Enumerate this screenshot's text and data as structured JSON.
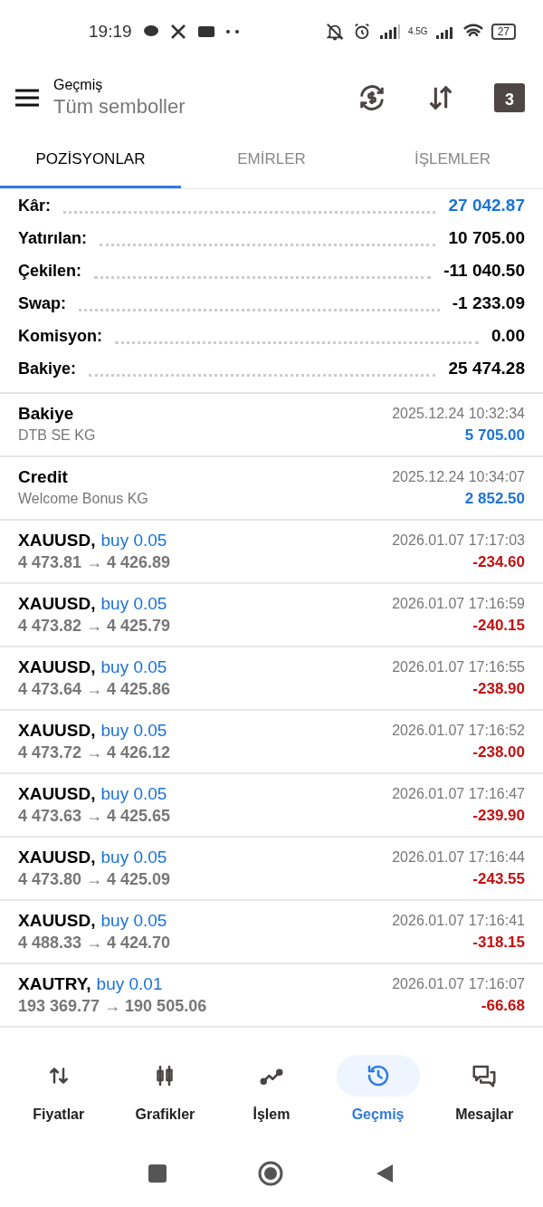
{
  "status_bar": {
    "time": "19:19",
    "network": "4.5G",
    "battery": "27"
  },
  "header": {
    "title": "Geçmiş",
    "subtitle": "Tüm semboller",
    "calendar_day": "3"
  },
  "tabs": [
    {
      "label": "POZİSYONLAR",
      "selected": true
    },
    {
      "label": "EMİRLER",
      "selected": false
    },
    {
      "label": "İŞLEMLER",
      "selected": false
    }
  ],
  "summary": [
    {
      "label": "Kâr:",
      "value": "27 042.87",
      "highlighted": true
    },
    {
      "label": "Yatırılan:",
      "value": "10 705.00",
      "highlighted": false
    },
    {
      "label": "Çekilen:",
      "value": "-11 040.50",
      "highlighted": false
    },
    {
      "label": "Swap:",
      "value": "-1 233.09",
      "highlighted": false
    },
    {
      "label": "Komisyon:",
      "value": "0.00",
      "highlighted": false
    },
    {
      "label": "Bakiye:",
      "value": "25 474.28",
      "highlighted": false
    }
  ],
  "deals": [
    {
      "kind": "balance",
      "title": "Bakiye",
      "comment": "DTB SE KG",
      "time": "2025.12.24 10:32:34",
      "amount": "5 705.00",
      "color": "#1a73d9"
    },
    {
      "kind": "balance",
      "title": "Credit",
      "comment": "Welcome Bonus KG",
      "time": "2025.12.24 10:34:07",
      "amount": "2 852.50",
      "color": "#1a73d9"
    },
    {
      "kind": "trade",
      "title": "XAUUSD,",
      "side": "buy 0.05",
      "prices": "4 473.81 → 4 426.89",
      "time": "2026.01.07 17:17:03",
      "amount": "-234.60",
      "color": "#c41010"
    },
    {
      "kind": "trade",
      "title": "XAUUSD,",
      "side": "buy 0.05",
      "prices": "4 473.82 → 4 425.79",
      "time": "2026.01.07 17:16:59",
      "amount": "-240.15",
      "color": "#c41010"
    },
    {
      "kind": "trade",
      "title": "XAUUSD,",
      "side": "buy 0.05",
      "prices": "4 473.64 → 4 425.86",
      "time": "2026.01.07 17:16:55",
      "amount": "-238.90",
      "color": "#c41010"
    },
    {
      "kind": "trade",
      "title": "XAUUSD,",
      "side": "buy 0.05",
      "prices": "4 473.72 → 4 426.12",
      "time": "2026.01.07 17:16:52",
      "amount": "-238.00",
      "color": "#c41010"
    },
    {
      "kind": "trade",
      "title": "XAUUSD,",
      "side": "buy 0.05",
      "prices": "4 473.63 → 4 425.65",
      "time": "2026.01.07 17:16:47",
      "amount": "-239.90",
      "color": "#c41010"
    },
    {
      "kind": "trade",
      "title": "XAUUSD,",
      "side": "buy 0.05",
      "prices": "4 473.80 → 4 425.09",
      "time": "2026.01.07 17:16:44",
      "amount": "-243.55",
      "color": "#c41010"
    },
    {
      "kind": "trade",
      "title": "XAUUSD,",
      "side": "buy 0.05",
      "prices": "4 488.33 → 4 424.70",
      "time": "2026.01.07 17:16:41",
      "amount": "-318.15",
      "color": "#c41010"
    },
    {
      "kind": "trade",
      "title": "XAUTRY,",
      "side": "buy 0.01",
      "prices": "193 369.77 → 190 505.06",
      "time": "2026.01.07 17:16:07",
      "amount": "-66.68",
      "color": "#c41010"
    }
  ],
  "bottom_nav": [
    {
      "kind": "quotes",
      "label": "Fiyatlar",
      "selected": false
    },
    {
      "kind": "charts",
      "label": "Grafikler",
      "selected": false
    },
    {
      "kind": "trade",
      "label": "İşlem",
      "selected": false
    },
    {
      "kind": "history",
      "label": "Geçmiş",
      "selected": true
    },
    {
      "kind": "messages",
      "label": "Mesajlar",
      "selected": false
    }
  ]
}
